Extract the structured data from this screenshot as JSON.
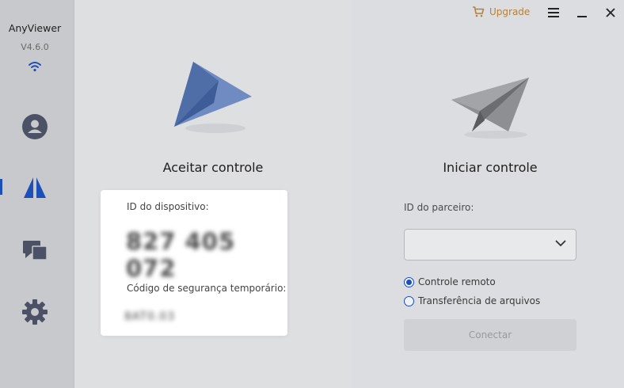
{
  "app": {
    "name": "AnyViewer",
    "version": "V4.6.0"
  },
  "sidebar": {
    "items": [
      {
        "icon": "user-icon",
        "active": false
      },
      {
        "icon": "remote-control-icon",
        "active": true
      },
      {
        "icon": "devices-icon",
        "active": false
      },
      {
        "icon": "gear-icon",
        "active": false
      }
    ]
  },
  "topbar": {
    "upgrade_label": "Upgrade"
  },
  "accept": {
    "title": "Aceitar controle",
    "device_id_label": "ID do dispositivo:",
    "device_id_value": "827 405 072",
    "security_code_label": "Código de segurança temporário:",
    "security_code_value": "8AT0.03"
  },
  "start": {
    "title": "Iniciar controle",
    "partner_id_label": "ID do parceiro:",
    "partner_id_value": "",
    "options": [
      {
        "label": "Controle remoto",
        "selected": true
      },
      {
        "label": "Transferência de arquivos",
        "selected": false
      }
    ],
    "connect_label": "Conectar"
  },
  "colors": {
    "accent": "#1d4fb8",
    "upgrade": "#b6813a"
  }
}
